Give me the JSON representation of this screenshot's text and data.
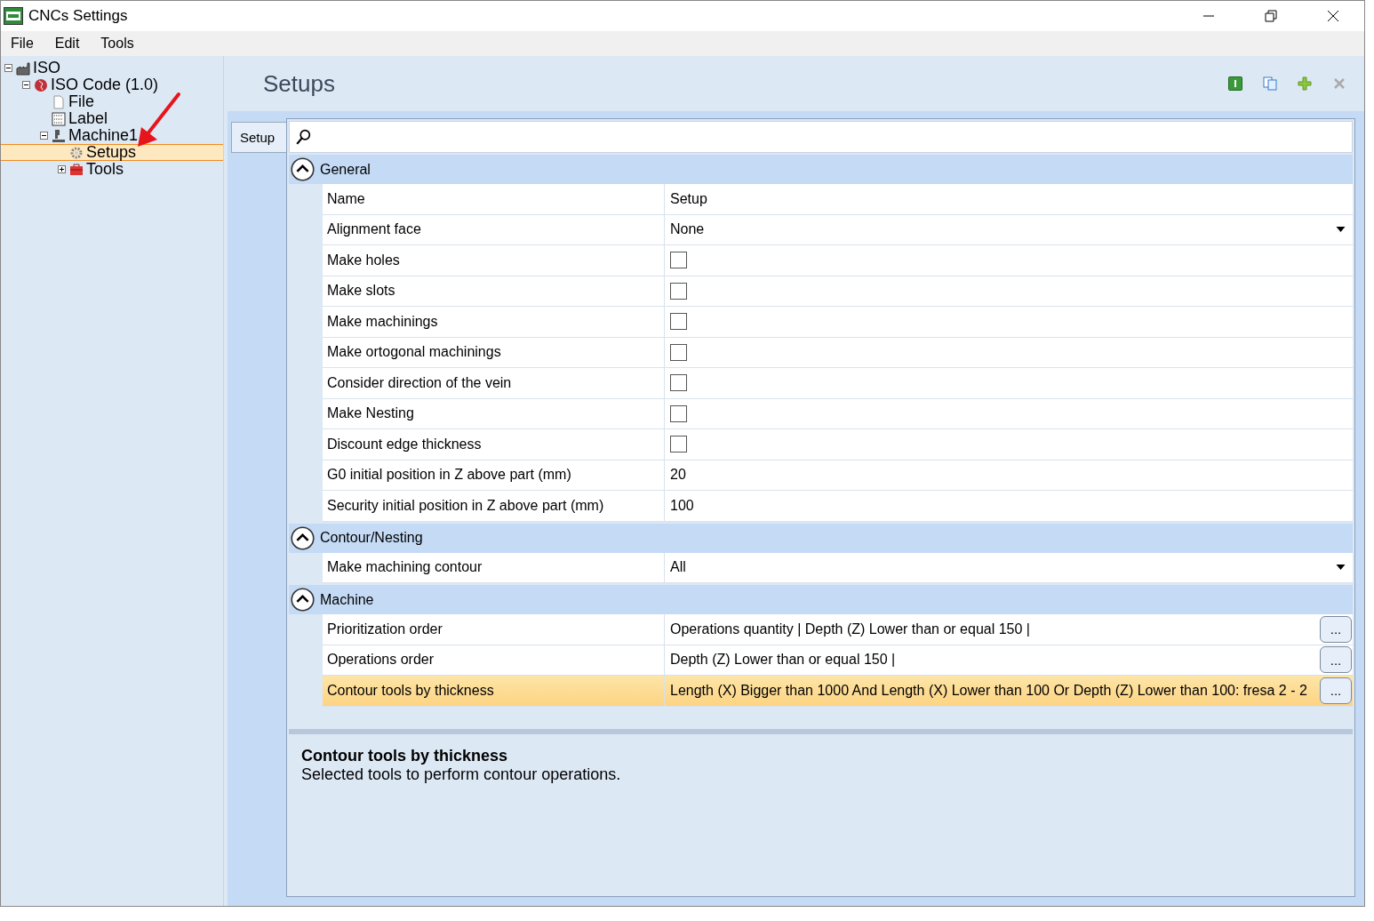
{
  "window": {
    "title": "CNCs Settings"
  },
  "menu": [
    "File",
    "Edit",
    "Tools"
  ],
  "tree": [
    {
      "label": "ISO",
      "kind": "factory",
      "expanded": true,
      "selected": false,
      "children": [
        {
          "label": "ISO Code (1.0)",
          "kind": "code",
          "expanded": true,
          "selected": false,
          "children": [
            {
              "label": "File",
              "kind": "file",
              "selected": false
            },
            {
              "label": "Label",
              "kind": "label",
              "selected": false
            },
            {
              "label": "Machine1",
              "kind": "machine",
              "expanded": true,
              "selected": false,
              "children": [
                {
                  "label": "Setups",
                  "kind": "gear",
                  "selected": true
                },
                {
                  "label": "Tools",
                  "kind": "toolbox",
                  "expanded": false,
                  "selected": false
                }
              ]
            }
          ]
        }
      ]
    }
  ],
  "header": {
    "title": "Setups"
  },
  "tabs": [
    {
      "label": "Setup",
      "selected": true
    }
  ],
  "groups": [
    {
      "title": "General",
      "expanded": true,
      "rows": [
        {
          "kind": "text",
          "name": "Name",
          "value": "Setup",
          "selected": false
        },
        {
          "kind": "dropdown",
          "name": "Alignment face",
          "value": "None",
          "selected": false
        },
        {
          "kind": "checkbox",
          "name": "Make holes",
          "checked": false,
          "selected": false
        },
        {
          "kind": "checkbox",
          "name": "Make slots",
          "checked": false,
          "selected": false
        },
        {
          "kind": "checkbox",
          "name": "Make machinings",
          "checked": false,
          "selected": false
        },
        {
          "kind": "checkbox",
          "name": "Make ortogonal machinings",
          "checked": false,
          "selected": false
        },
        {
          "kind": "checkbox",
          "name": "Consider direction of the vein",
          "checked": false,
          "selected": false
        },
        {
          "kind": "checkbox",
          "name": "Make Nesting",
          "checked": false,
          "selected": false
        },
        {
          "kind": "checkbox",
          "name": "Discount edge thickness",
          "checked": false,
          "selected": false
        },
        {
          "kind": "text",
          "name": "G0 initial position in Z above part (mm)",
          "value": "20",
          "selected": false
        },
        {
          "kind": "text",
          "name": "Security initial position in Z above part (mm)",
          "value": "100",
          "selected": false
        }
      ]
    },
    {
      "title": "Contour/Nesting",
      "expanded": true,
      "rows": [
        {
          "kind": "dropdown",
          "name": "Make machining contour",
          "value": "All",
          "selected": false
        }
      ]
    },
    {
      "title": "Machine",
      "expanded": true,
      "rows": [
        {
          "kind": "ellipsis",
          "name": "Prioritization order",
          "value": "Operations quantity | Depth (Z) Lower than or equal 150 |",
          "button": "...",
          "selected": false
        },
        {
          "kind": "ellipsis",
          "name": "Operations order",
          "value": "Depth (Z) Lower than or equal 150 |",
          "button": "...",
          "selected": false
        },
        {
          "kind": "ellipsis",
          "name": "Contour tools by thickness",
          "value": "Length (X) Bigger than 1000 And Length (X) Lower than 100 Or Depth (Z) Lower than 100: fresa 2 - 2",
          "button": "...",
          "selected": true
        }
      ]
    }
  ],
  "description": {
    "title": "Contour tools by thickness",
    "text": "Selected tools to perform contour operations."
  }
}
